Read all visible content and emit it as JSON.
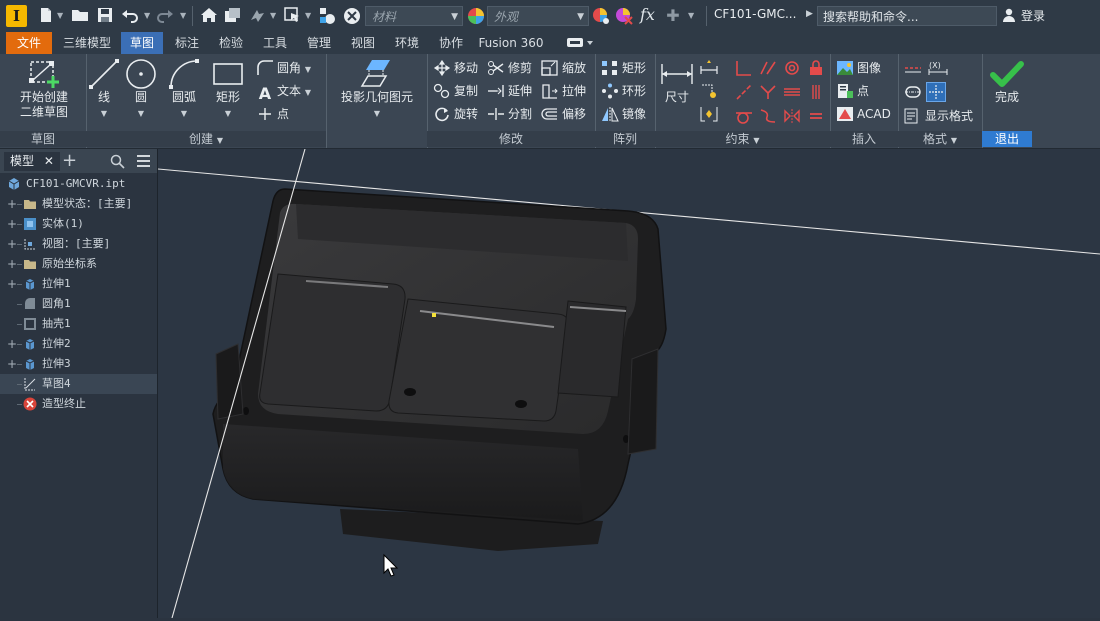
{
  "app": {
    "logo": "I"
  },
  "qat": {
    "material_placeholder": "材料",
    "appearance_placeholder": "外观",
    "fx_label": "fx",
    "doc_title": "CF101-GMC...",
    "search_placeholder": "搜索帮助和命令...",
    "login_label": "登录"
  },
  "tabs": [
    {
      "label": "文件",
      "state": "file"
    },
    {
      "label": "三维模型",
      "state": ""
    },
    {
      "label": "草图",
      "state": "active"
    },
    {
      "label": "标注",
      "state": ""
    },
    {
      "label": "检验",
      "state": ""
    },
    {
      "label": "工具",
      "state": ""
    },
    {
      "label": "管理",
      "state": ""
    },
    {
      "label": "视图",
      "state": ""
    },
    {
      "label": "环境",
      "state": ""
    },
    {
      "label": "协作",
      "state": ""
    },
    {
      "label": "Fusion 360",
      "state": ""
    }
  ],
  "ribbon": {
    "sketch_group": {
      "start_line1": "开始创建",
      "start_line2": "二维草图",
      "label": "草图"
    },
    "create_group": {
      "line": "线",
      "circle": "圆",
      "arc": "圆弧",
      "rect": "矩形",
      "fillet": "圆角",
      "text": "文本",
      "point": "点",
      "label": "创建"
    },
    "project_group": {
      "project": "投影几何图元"
    },
    "modify_group": {
      "move": "移动",
      "trim": "修剪",
      "scale": "缩放",
      "copy": "复制",
      "extend": "延伸",
      "stretch": "拉伸",
      "rotate": "旋转",
      "split": "分割",
      "offset": "偏移",
      "label": "修改"
    },
    "pattern_group": {
      "rect": "矩形",
      "circular": "环形",
      "mirror": "镜像",
      "label": "阵列"
    },
    "constrain_group": {
      "dimension": "尺寸",
      "label": "约束"
    },
    "insert_group": {
      "image": "图像",
      "point": "点",
      "acad": "ACAD",
      "label": "插入"
    },
    "format_group": {
      "show_format": "显示格式",
      "label": "格式"
    },
    "exit_group": {
      "finish": "完成",
      "label": "退出"
    }
  },
  "browser": {
    "tab_label": "模型",
    "items": [
      {
        "label": "CF101-GMCVR.ipt",
        "expand": "",
        "icon": "part-icon",
        "indent": 0
      },
      {
        "label": "模型状态：[主要]",
        "expand": "+",
        "icon": "folder-icon",
        "indent": 1
      },
      {
        "label": "实体(1)",
        "expand": "+",
        "icon": "solid-body-icon",
        "indent": 1
      },
      {
        "label": "视图：[主要]",
        "expand": "+",
        "icon": "view-icon",
        "indent": 1
      },
      {
        "label": "原始坐标系",
        "expand": "+",
        "icon": "folder-icon",
        "indent": 1
      },
      {
        "label": "拉伸1",
        "expand": "+",
        "icon": "extrude-icon",
        "indent": 1
      },
      {
        "label": "圆角1",
        "expand": "",
        "icon": "fillet-icon",
        "indent": 1
      },
      {
        "label": "抽壳1",
        "expand": "",
        "icon": "shell-icon",
        "indent": 1
      },
      {
        "label": "拉伸2",
        "expand": "+",
        "icon": "extrude-icon",
        "indent": 1
      },
      {
        "label": "拉伸3",
        "expand": "+",
        "icon": "extrude-icon",
        "indent": 1
      },
      {
        "label": "草图4",
        "expand": "",
        "icon": "sketch-icon",
        "indent": 1,
        "selected": true
      },
      {
        "label": "造型终止",
        "expand": "",
        "icon": "end-of-part-icon",
        "indent": 1
      }
    ]
  },
  "colors": {
    "file_tab": "#e36b0d",
    "active_tab": "#3b6fb6",
    "exit_label": "#2f7bd1",
    "finish_check": "#37c04a",
    "viewport_bg": "#2c3643"
  }
}
